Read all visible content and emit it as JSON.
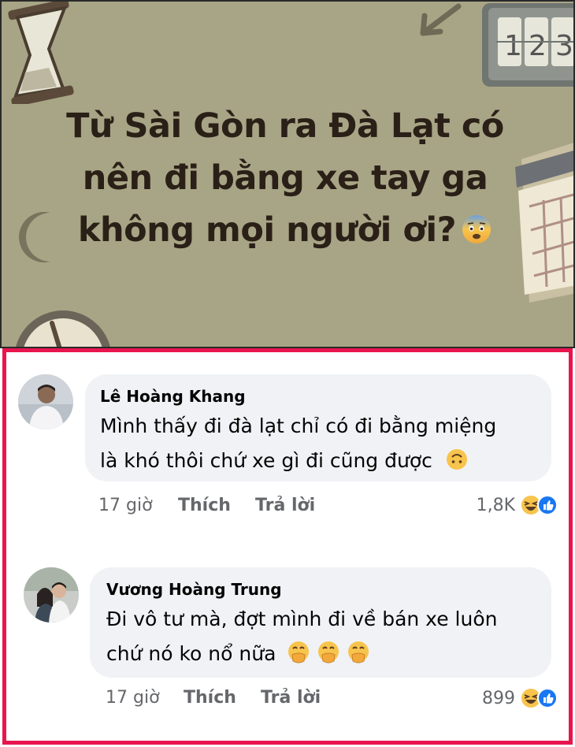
{
  "post": {
    "title_lines": [
      "Từ Sài Gòn ra Đà Lạt có",
      "nên đi bằng xe tay ga",
      "không mọi người ơi?"
    ],
    "background": "#a8a586"
  },
  "comments": [
    {
      "author": "Lê Hoàng Khang",
      "text_lines": [
        "Mình thấy đi đà lạt chỉ có đi bằng miệng",
        "là khó thôi chứ xe gì đi cũng được"
      ],
      "time": "17 giờ",
      "like_label": "Thích",
      "reply_label": "Trả lời",
      "reaction_count": "1,8K"
    },
    {
      "author": "Vương Hoàng Trung",
      "text_lines": [
        "Đi vô tư mà, đợt mình đi về bán xe luôn",
        "chứ nó ko nổ nữa"
      ],
      "time": "17 giờ",
      "like_label": "Thích",
      "reply_label": "Trả lời",
      "reaction_count": "899"
    }
  ],
  "colors": {
    "frame": "#e8154e",
    "bubble": "#f0f2f5",
    "like_blue": "#1877f2",
    "meta_gray": "#65676b"
  },
  "icons": [
    "hourglass-icon",
    "moon-icon",
    "arrow-icon",
    "flip-clock-icon",
    "calendar-icon",
    "clock-icon",
    "fearful-face-emoji",
    "upside-down-face-emoji",
    "laughing-emoji",
    "like-emoji",
    "face-with-hand-over-mouth-emoji"
  ]
}
